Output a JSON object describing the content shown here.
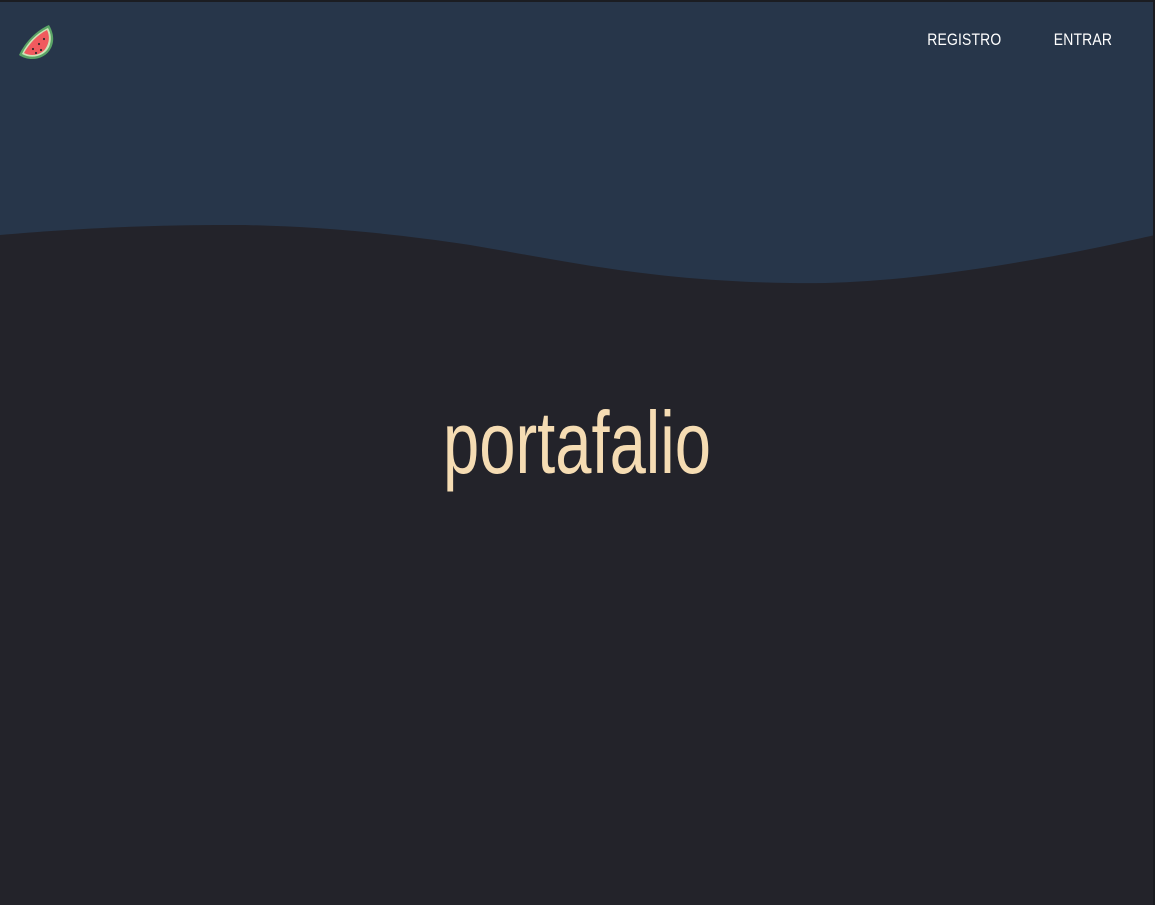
{
  "header": {
    "logo_icon": "watermelon-icon",
    "nav": [
      {
        "label": "REGISTRO"
      },
      {
        "label": "ENTRAR"
      }
    ]
  },
  "hero": {
    "title": "portafalio"
  },
  "colors": {
    "header_bg": "#27364a",
    "page_bg": "#23232a",
    "title": "#f5dcb3",
    "nav_text": "#ffffff"
  }
}
